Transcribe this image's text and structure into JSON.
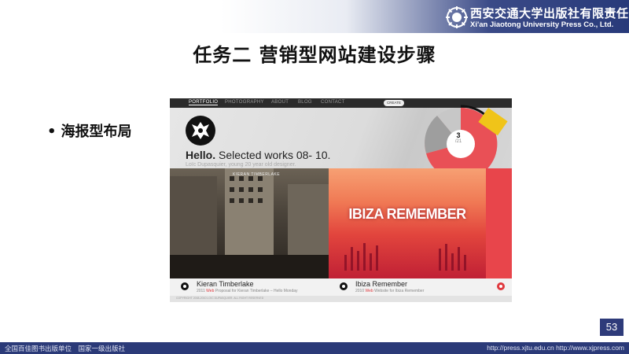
{
  "header": {
    "publisher_cn": "西安交通大学出版社有限责任公司",
    "publisher_en": "Xi'an Jiaotong University Press Co., Ltd.",
    "logo_icon": "university-press-logo-icon"
  },
  "slide": {
    "title": "任务二 营销型网站建设步骤",
    "bullet": "海报型布局",
    "bullet_mark": "•",
    "page_number": "53"
  },
  "website": {
    "nav": [
      "PORTFOLIO",
      "PHOTOGRAPHY",
      "ABOUT",
      "BLOG",
      "CONTACT"
    ],
    "nav_active": "PORTFOLIO",
    "login_label": "CREATE",
    "hero_hello": "Hello.",
    "hero_title": "Selected works 08- 10.",
    "hero_subtitle": "Loïc Dupasquier, young 20 year old designer.",
    "counter_current": "3",
    "counter_total": "/21",
    "projects": [
      {
        "image_label": "KIERAN TIMBERLAKE",
        "title": "Kieran Timberlake",
        "year": "2011",
        "tag": "Web",
        "desc": "Proposal for Kieran Timberlake – Hello Monday"
      },
      {
        "image_label": "IBIZA REMEMBER",
        "title": "Ibiza Remember",
        "year": "2010",
        "tag": "Web",
        "desc": "Website for Ibiza Remember"
      }
    ],
    "footer": "COPYRIGHT 2008-2010 LOIC DUPASQUIER. ALL RIGHT RESERVED"
  },
  "footer": {
    "left": "全国百佳图书出版单位　国家一级出版社",
    "right": "http://press.xjtu.edu.cn  http://www.xjpress.com"
  },
  "colors": {
    "brand_blue": "#2b3a78",
    "accent_red": "#e0393e"
  }
}
